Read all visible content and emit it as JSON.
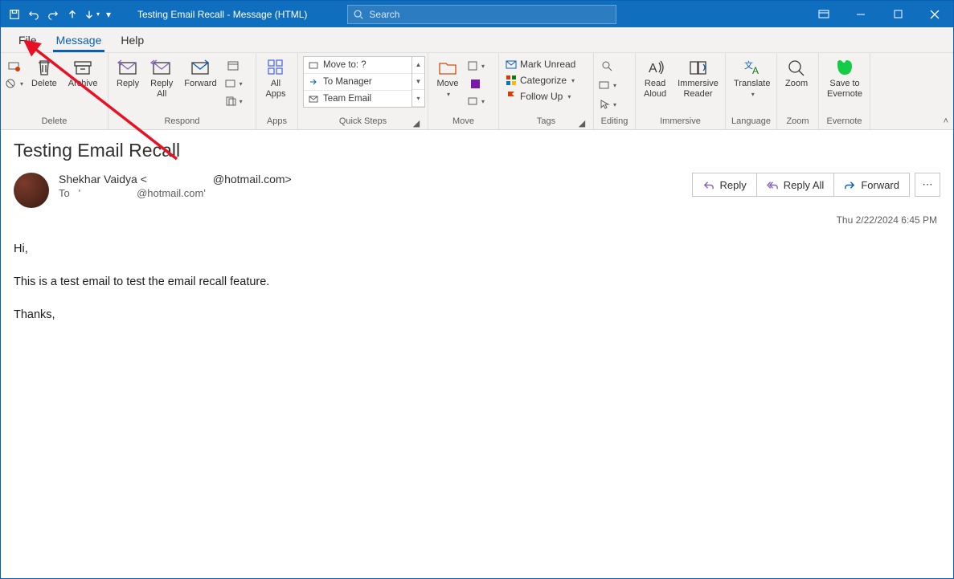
{
  "title": "Testing Email Recall  -  Message (HTML)",
  "search": {
    "placeholder": "Search"
  },
  "tabs": {
    "file": "File",
    "message": "Message",
    "help": "Help"
  },
  "ribbon": {
    "delete": {
      "delete": "Delete",
      "archive": "Archive",
      "label": "Delete"
    },
    "respond": {
      "reply": "Reply",
      "replyAll": "Reply\nAll",
      "forward": "Forward",
      "label": "Respond"
    },
    "apps": {
      "allApps": "All\nApps",
      "label": "Apps"
    },
    "quicksteps": {
      "r1": "Move to: ?",
      "r2": "To Manager",
      "r3": "Team Email",
      "label": "Quick Steps"
    },
    "move": {
      "move": "Move",
      "label": "Move"
    },
    "tags": {
      "unread": "Mark Unread",
      "categorize": "Categorize",
      "followup": "Follow Up",
      "label": "Tags"
    },
    "editing": {
      "label": "Editing"
    },
    "immersive": {
      "readAloud": "Read\nAloud",
      "immersiveReader": "Immersive\nReader",
      "label": "Immersive"
    },
    "language": {
      "translate": "Translate",
      "label": "Language"
    },
    "zoom": {
      "zoom": "Zoom",
      "label": "Zoom"
    },
    "evernote": {
      "save": "Save to\nEvernote",
      "label": "Evernote"
    }
  },
  "message": {
    "subject": "Testing Email Recall",
    "fromName": "Shekhar Vaidya <",
    "fromDomain": "@hotmail.com>",
    "toLabel": "To",
    "toAddr": "@hotmail.com'",
    "actions": {
      "reply": "Reply",
      "replyAll": "Reply All",
      "forward": "Forward"
    },
    "timestamp": "Thu 2/22/2024 6:45 PM",
    "body": {
      "p1": "Hi,",
      "p2": "This is a test email to test the email recall feature.",
      "p3": "Thanks,"
    }
  }
}
